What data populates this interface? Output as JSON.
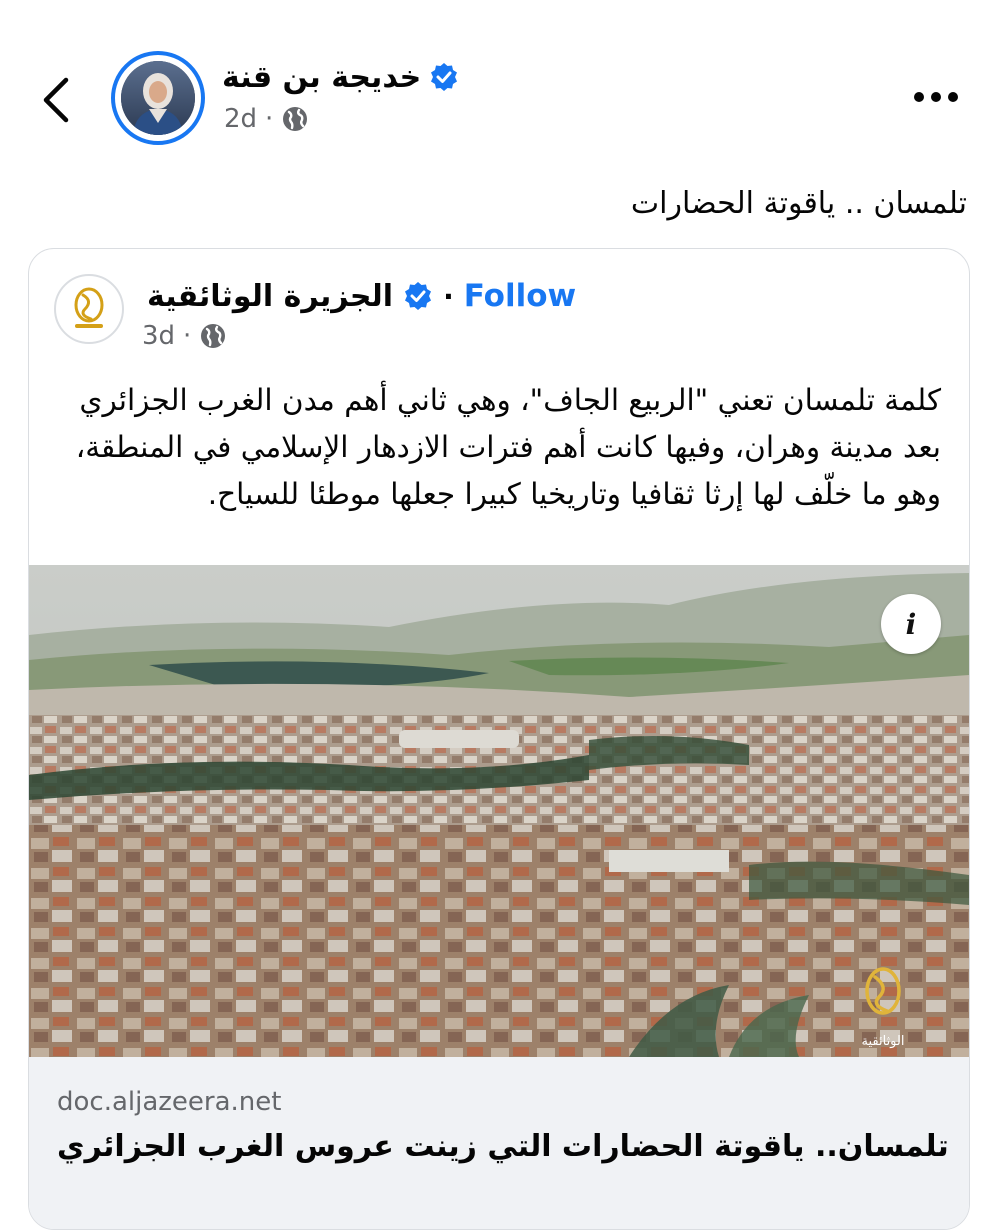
{
  "header": {
    "author_name": "خديجة  بن قنة",
    "time": "2d",
    "dot": "·"
  },
  "post": {
    "caption": "تلمسان .. ياقوتة الحضارات"
  },
  "shared": {
    "page_name": "الجزيرة  الوثائقية",
    "dot": "·",
    "follow_label": "Follow",
    "time": "3d",
    "body": "كلمة تلمسان تعني \"الربيع الجاف\"، وهي ثاني أهم مدن الغرب الجزائري بعد مدينة وهران، وفيها كانت أهم فترات الازدهار الإسلامي في المنطقة، وهو ما خلّف لها إرثا ثقافيا وتاريخيا كبيرا جعلها موطئا للسياح.",
    "watermark_text": "الوثائقية",
    "link_domain": "doc.aljazeera.net",
    "link_title": "تلمسان.. ياقوتة الحضارات التي زينت عروس الغرب الجزائري"
  },
  "colors": {
    "accent": "#1877f2",
    "meta_gray": "#65676b",
    "link_bg": "#f0f2f5",
    "logo_gold": "#d4a017"
  },
  "icons": [
    "back-chevron-icon",
    "verified-badge-icon",
    "globe-icon",
    "more-options-icon",
    "info-icon",
    "aljazeera-logo"
  ]
}
